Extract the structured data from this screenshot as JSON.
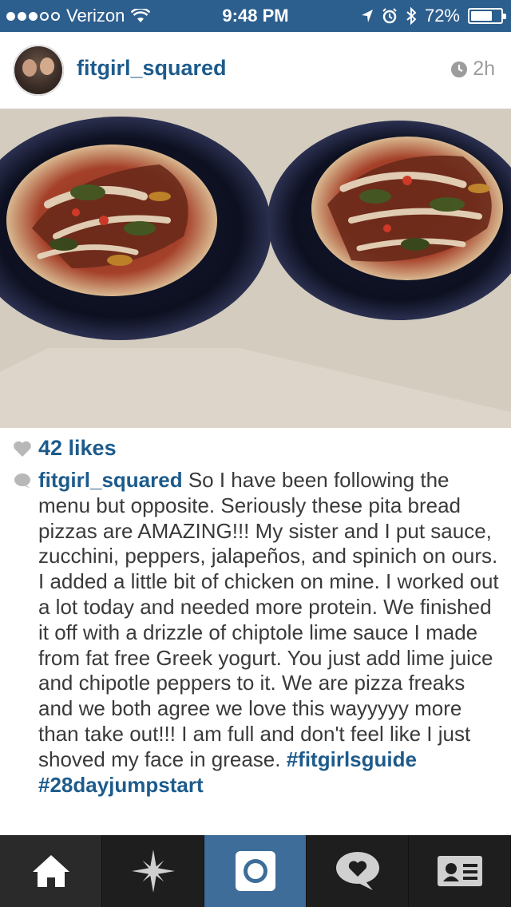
{
  "status_bar": {
    "carrier": "Verizon",
    "time": "9:48 PM",
    "battery": "72%",
    "battery_level": 0.72
  },
  "post": {
    "username": "fitgirl_squared",
    "time_ago": "2h",
    "likes": "42 likes",
    "caption_author": "fitgirl_squared",
    "caption_body": " So I have been following the menu but opposite. Seriously these pita bread pizzas are AMAZING!!! My sister and I put sauce, zucchini, peppers, jalapeños, and spinich on ours. I added a little bit of chicken on mine. I worked out a lot today and needed more protein. We finished it off with a drizzle of chiptole lime sauce I made from fat free Greek yogurt. You just add lime juice and chipotle peppers to it. We are pizza freaks and we both agree we love this wayyyyy more than take out!!! I am full and don't feel like I just shoved my face in grease. ",
    "hashtags": [
      "#fitgirlsguide",
      "#28dayjumpstart"
    ]
  },
  "tab_bar": {
    "items": [
      "home",
      "explore",
      "camera",
      "activity",
      "profile"
    ]
  },
  "colors": {
    "accent": "#1d5b8c",
    "status_bar": "#2d5f8e",
    "tab_active": "#3d6d98"
  }
}
